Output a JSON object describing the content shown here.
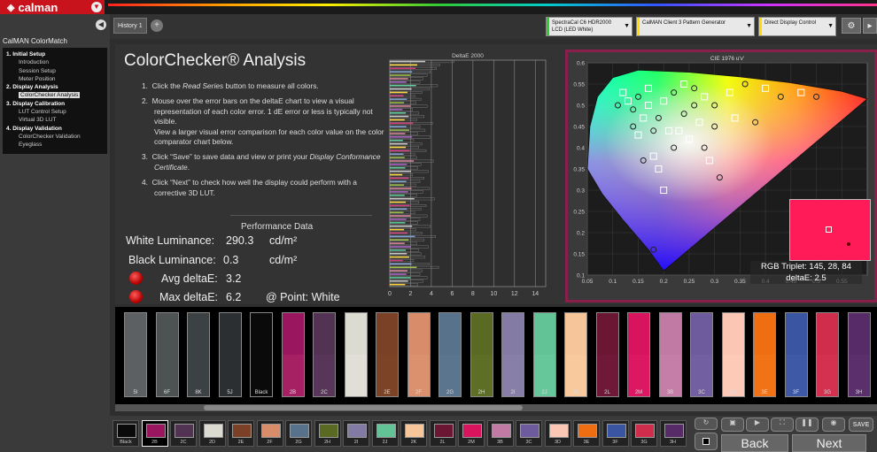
{
  "app": {
    "logo": "calman"
  },
  "nav": {
    "title": "CalMAN ColorMatch",
    "items": [
      {
        "label": "1. Initial Setup",
        "type": "step"
      },
      {
        "label": "Introduction",
        "type": "sub"
      },
      {
        "label": "Session Setup",
        "type": "sub"
      },
      {
        "label": "Meter Position",
        "type": "sub"
      },
      {
        "label": "2. Display Analysis",
        "type": "step"
      },
      {
        "label": "ColorChecker Analysis",
        "type": "sub",
        "active": true
      },
      {
        "label": "3. Display Calibration",
        "type": "step"
      },
      {
        "label": "LUT Control Setup",
        "type": "sub"
      },
      {
        "label": "Virtual 3D LUT",
        "type": "sub"
      },
      {
        "label": "4. Display Validation",
        "type": "step"
      },
      {
        "label": "ColorChecker Validation",
        "type": "sub"
      },
      {
        "label": "Eyeglass",
        "type": "sub"
      }
    ]
  },
  "tabs": {
    "history": "History 1",
    "add": "+"
  },
  "devices": {
    "meter_line1": "SpectraCal C6 HDR2000",
    "meter_line2": "LCD (LED White)",
    "generator": "CalMAN Client 3 Pattern Generator",
    "display": "Direct Display Control"
  },
  "page": {
    "title": "ColorChecker® Analysis",
    "steps": [
      "Click the <i>Read Series</i> button to measure all colors.",
      "Mouse over the error bars on the deltaE chart to view a visual representation of each color error. 1 dE error or less is typically not visible.<br>View a larger visual error comparison for each color value on the color comparator chart below.",
      "Click “Save” to save data and view or print your <i>Display Conformance Certificate</i>.",
      "Click “Next” to check how well the display could perform with a corrective 3D LUT."
    ]
  },
  "performance": {
    "title": "Performance Data",
    "white_label": "White Luminance:",
    "white_value": "290.3",
    "white_unit": "cd/m²",
    "black_label": "Black Luminance:",
    "black_value": "0.3",
    "black_unit": "cd/m²",
    "avg_label": "Avg deltaE:",
    "avg_value": "3.2",
    "max_label": "Max deltaE:",
    "max_value": "6.2",
    "point": "@ Point: White"
  },
  "chart_data": [
    {
      "type": "bar",
      "title": "DeltaE 2000",
      "xlim": [
        0,
        15
      ],
      "xticks": [
        0,
        2,
        4,
        6,
        8,
        10,
        12,
        14
      ],
      "grid": true,
      "values": [
        6.2,
        4.8,
        4.5,
        3.9,
        3.6,
        3.2,
        2.9,
        4.6,
        3.8,
        3.1,
        2.4,
        3.0,
        2.5,
        3.6,
        2.2,
        2.8,
        3.3,
        2.6,
        4.1,
        2.9,
        3.4,
        2.7,
        3.9,
        2.3,
        3.1,
        2.8,
        3.5,
        2.4,
        2.6,
        4.2,
        3.0,
        2.7,
        3.7,
        2.2,
        3.3,
        2.9,
        2.5,
        3.8,
        3.2,
        2.6,
        4.3,
        2.8,
        3.5,
        3.0,
        2.4,
        3.6,
        2.9,
        2.7,
        3.9,
        2.5,
        3.1,
        4.4,
        3.3,
        2.6,
        3.7,
        2.8,
        3.0,
        3.4,
        2.3,
        3.8,
        4.7,
        3.1,
        2.9,
        3.6,
        3.2,
        2.7
      ]
    },
    {
      "type": "scatter",
      "title": "CIE 1976 u'v'",
      "xlim": [
        0.05,
        0.6
      ],
      "ylim": [
        0.1,
        0.6
      ],
      "xticks": [
        0.05,
        0.1,
        0.15,
        0.2,
        0.25,
        0.3,
        0.35,
        0.4,
        0.45,
        0.5,
        0.55
      ],
      "yticks": [
        0.1,
        0.15,
        0.2,
        0.25,
        0.3,
        0.35,
        0.4,
        0.45,
        0.5,
        0.55,
        0.6
      ],
      "points": [
        [
          0.17,
          0.54
        ],
        [
          0.15,
          0.52
        ],
        [
          0.12,
          0.53
        ],
        [
          0.14,
          0.49
        ],
        [
          0.16,
          0.47
        ],
        [
          0.14,
          0.45
        ],
        [
          0.15,
          0.43
        ],
        [
          0.18,
          0.44
        ],
        [
          0.18,
          0.38
        ],
        [
          0.16,
          0.37
        ],
        [
          0.19,
          0.35
        ],
        [
          0.22,
          0.4
        ],
        [
          0.21,
          0.44
        ],
        [
          0.19,
          0.47
        ],
        [
          0.2,
          0.51
        ],
        [
          0.22,
          0.53
        ],
        [
          0.24,
          0.55
        ],
        [
          0.26,
          0.54
        ],
        [
          0.28,
          0.52
        ],
        [
          0.3,
          0.5
        ],
        [
          0.33,
          0.53
        ],
        [
          0.36,
          0.55
        ],
        [
          0.4,
          0.54
        ],
        [
          0.43,
          0.52
        ],
        [
          0.47,
          0.53
        ],
        [
          0.5,
          0.52
        ],
        [
          0.27,
          0.46
        ],
        [
          0.3,
          0.45
        ],
        [
          0.34,
          0.47
        ],
        [
          0.38,
          0.46
        ],
        [
          0.25,
          0.42
        ],
        [
          0.28,
          0.4
        ],
        [
          0.29,
          0.37
        ],
        [
          0.31,
          0.33
        ],
        [
          0.2,
          0.3
        ],
        [
          0.18,
          0.16
        ],
        [
          0.13,
          0.51
        ],
        [
          0.11,
          0.5
        ],
        [
          0.17,
          0.5
        ],
        [
          0.24,
          0.48
        ],
        [
          0.23,
          0.44
        ],
        [
          0.26,
          0.5
        ]
      ]
    }
  ],
  "comparator": {
    "swatches": [
      {
        "label": "5I",
        "top": "#5c6062",
        "bottom": "#5c6062"
      },
      {
        "label": "6F",
        "top": "#4d5253",
        "bottom": "#4d5253"
      },
      {
        "label": "8K",
        "top": "#3c4244",
        "bottom": "#3c4244"
      },
      {
        "label": "5J",
        "top": "#2c2f31",
        "bottom": "#2c2f31"
      },
      {
        "label": "Black",
        "top": "#0a0a0a",
        "bottom": "#0a0a0a"
      },
      {
        "label": "2B",
        "top": "#9a1760",
        "bottom": "#a52164"
      },
      {
        "label": "2C",
        "top": "#523353",
        "bottom": "#57365a"
      },
      {
        "label": "2D",
        "top": "#dcdbd2",
        "bottom": "#e0ded6"
      },
      {
        "label": "2E",
        "top": "#7a4126",
        "bottom": "#7d4327"
      },
      {
        "label": "2F",
        "top": "#d98c6a",
        "bottom": "#dc916e"
      },
      {
        "label": "2G",
        "top": "#57728a",
        "bottom": "#5a758d"
      },
      {
        "label": "2H",
        "top": "#5a6a22",
        "bottom": "#5e6e25"
      },
      {
        "label": "2I",
        "top": "#837ba3",
        "bottom": "#877fa7"
      },
      {
        "label": "2J",
        "top": "#62c396",
        "bottom": "#66c79a"
      },
      {
        "label": "2K",
        "top": "#f7c59a",
        "bottom": "#f9c99e"
      },
      {
        "label": "2L",
        "top": "#6b1633",
        "bottom": "#6f1837"
      },
      {
        "label": "2M",
        "top": "#d9145f",
        "bottom": "#dc1863"
      },
      {
        "label": "3B",
        "top": "#c07aa4",
        "bottom": "#c47ea8"
      },
      {
        "label": "3C",
        "top": "#6e5b9d",
        "bottom": "#725fa1"
      },
      {
        "label": "3D",
        "top": "#fbc6b3",
        "bottom": "#fdcab7"
      },
      {
        "label": "3E",
        "top": "#f06e12",
        "bottom": "#f27216"
      },
      {
        "label": "3F",
        "top": "#3a55a2",
        "bottom": "#3e59a6"
      },
      {
        "label": "3G",
        "top": "#d02c4c",
        "bottom": "#d43050"
      },
      {
        "label": "3H",
        "top": "#572a68",
        "bottom": "#5b2e6c"
      }
    ]
  },
  "bottom_strip": {
    "chips": [
      {
        "label": "Black",
        "color": "#0a0a0a"
      },
      {
        "label": "2B",
        "color": "#9a1760",
        "active": true
      },
      {
        "label": "2C",
        "color": "#523353"
      },
      {
        "label": "2D",
        "color": "#dcdbd2"
      },
      {
        "label": "2E",
        "color": "#7a4126"
      },
      {
        "label": "2F",
        "color": "#d98c6a"
      },
      {
        "label": "2G",
        "color": "#57728a"
      },
      {
        "label": "2H",
        "color": "#5a6a22"
      },
      {
        "label": "2I",
        "color": "#837ba3"
      },
      {
        "label": "2J",
        "color": "#62c396"
      },
      {
        "label": "2K",
        "color": "#f7c59a"
      },
      {
        "label": "2L",
        "color": "#6b1633"
      },
      {
        "label": "2M",
        "color": "#d9145f"
      },
      {
        "label": "3B",
        "color": "#c07aa4"
      },
      {
        "label": "3C",
        "color": "#6e5b9d"
      },
      {
        "label": "3D",
        "color": "#fbc6b3"
      },
      {
        "label": "3E",
        "color": "#f06e12"
      },
      {
        "label": "3F",
        "color": "#3a55a2"
      },
      {
        "label": "3G",
        "color": "#d02c4c"
      },
      {
        "label": "3H",
        "color": "#572a68"
      }
    ]
  },
  "controls": {
    "back": "Back",
    "next": "Next",
    "save": "SAVE"
  },
  "selection": {
    "rgb": "RGB Triplet: 145, 28, 84",
    "de": "deltaE: 2.5"
  }
}
